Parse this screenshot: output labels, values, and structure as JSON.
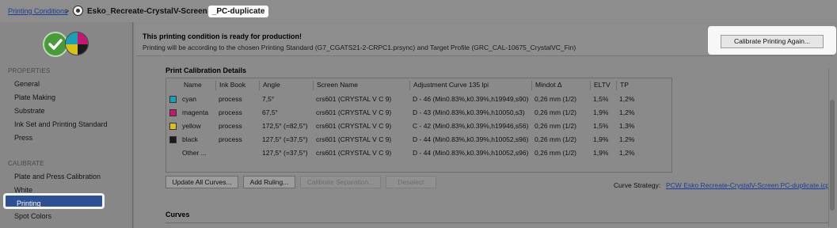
{
  "breadcrumb": {
    "parent": "Printing Conditions",
    "separator": ">",
    "current_main": "Esko_Recreate-CrystalV-Screen",
    "current_highlight": "_PC-duplicate"
  },
  "sidebar": {
    "sections": [
      {
        "heading": "PROPERTIES",
        "items": [
          "General",
          "Plate Making",
          "Substrate",
          "Ink Set and Printing Standard",
          "Press"
        ]
      },
      {
        "heading": "CALIBRATE",
        "items": [
          "Plate and Press Calibration",
          "White",
          "Printing",
          "Spot Colors"
        ]
      }
    ],
    "selected_item": "Printing"
  },
  "banner": {
    "title": "This printing condition is ready for production!",
    "subtitle": "Printing will be according to the chosen Printing Standard (G7_CGATS21-2-CRPC1.prsync) and Target Profile (GRC_CAL-10675_CrystalVC_Fin)",
    "calibrate_button": "Calibrate Printing Again..."
  },
  "details": {
    "title": "Print Calibration Details",
    "columns": [
      "Name",
      "Ink Book",
      "Angle",
      "Screen Name",
      "Adjustment Curve 135 lpi",
      "Mindot Δ",
      "ELTV",
      "TP"
    ],
    "rows": [
      {
        "color": "#1a9fb5",
        "name": "cyan",
        "ink_book": "process",
        "angle": "7,5°",
        "screen": "crs601 (CRYSTAL V C 9)",
        "curve": "D - 46 (Min0.83%,k0.39%,h19949,s90)",
        "mindot": "0,26 mm (1/2)",
        "eltv": "1,5%",
        "tp": "1,2%"
      },
      {
        "color": "#c2186f",
        "name": "magenta",
        "ink_book": "process",
        "angle": "67,5°",
        "screen": "crs601 (CRYSTAL V C 9)",
        "curve": "D - 43 (Min0.83%,k0.39%,h10050,s3)",
        "mindot": "0,26 mm (1/2)",
        "eltv": "1,9%",
        "tp": "1,2%"
      },
      {
        "color": "#d8c21a",
        "name": "yellow",
        "ink_book": "process",
        "angle": "172,5° (=82,5°)",
        "screen": "crs601 (CRYSTAL V C 9)",
        "curve": "C - 42 (Min0.83%,k0.39%,h19946,s56)",
        "mindot": "0,26 mm (1/2)",
        "eltv": "1,5%",
        "tp": "1,3%"
      },
      {
        "color": "#1a1a1a",
        "name": "black",
        "ink_book": "process",
        "angle": "127,5° (=37,5°)",
        "screen": "crs601 (CRYSTAL V C 9)",
        "curve": "D - 44 (Min0.83%,k0.39%,h10052,s96)",
        "mindot": "0,26 mm (1/2)",
        "eltv": "1,9%",
        "tp": "1,2%"
      },
      {
        "color": "",
        "name": "Other ...",
        "ink_book": "",
        "angle": "127,5° (=37,5°)",
        "screen": "crs601 (CRYSTAL V C 9)",
        "curve": "D - 44 (Min0.83%,k0.39%,h10052,s96)",
        "mindot": "0,26 mm (1/2)",
        "eltv": "1,9%",
        "tp": "1,2%"
      }
    ]
  },
  "actions": {
    "update_curves": "Update All Curves...",
    "add_ruling": "Add Ruling...",
    "calibrate_separation": "Calibrate Separation...",
    "deselect": "Deselect"
  },
  "curve_strategy": {
    "label": "Curve Strategy:",
    "value": "PCW Esko Recreate-CrystalV-Screen PC-duplicate.icpro"
  },
  "curves": {
    "title": "Curves"
  }
}
